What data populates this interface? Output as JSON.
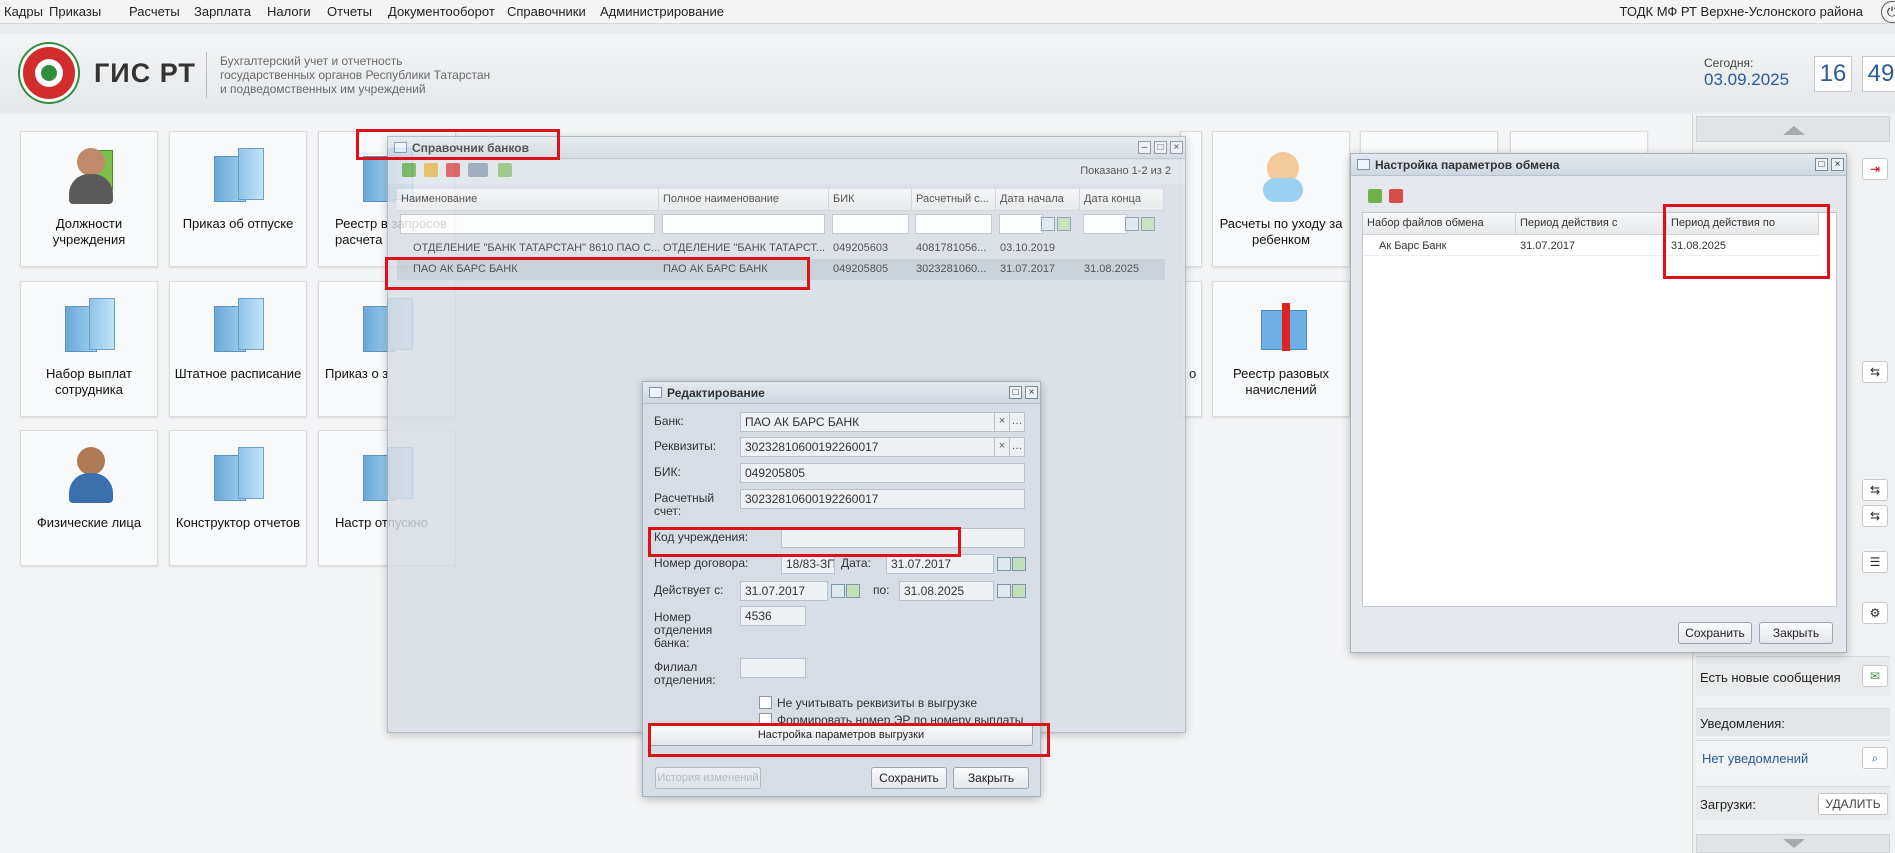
{
  "menu": {
    "items": [
      "Кадры",
      "Приказы",
      "Расчеты",
      "Зарплата",
      "Налоги",
      "Отчеты",
      "Документооборот",
      "Справочники",
      "Администрирование"
    ],
    "org": "ТОДК МФ РТ Верхне-Услонского района",
    "org_icon": "power-icon"
  },
  "header": {
    "brand": "ГИС РТ",
    "subtitle_1": "Бухгалтерский учет и отчетность",
    "subtitle_2": "государственных органов Республики Татарстан",
    "subtitle_3": "и подведомственных им учреждений",
    "today_label": "Сегодня:",
    "today_date": "03.09.2025",
    "hours": "16",
    "minutes": "49"
  },
  "tiles": [
    {
      "label": "Должности учреждения",
      "icon": "people-document-icon"
    },
    {
      "label": "Приказ об отпуске",
      "icon": "building-icon"
    },
    {
      "label": "Реестр в запросов расчета",
      "icon": "building-icon"
    },
    {
      "label": "Расчеты по уходу за ребенком",
      "icon": "baby-icon"
    },
    {
      "label": "Набор выплат сотрудника",
      "icon": "building-icon"
    },
    {
      "label": "Штатное расписание",
      "icon": "building-icon"
    },
    {
      "label": "Приказ о з",
      "icon": "building-icon"
    },
    {
      "label": "Реестр разовых начислений",
      "icon": "gift-icon"
    },
    {
      "label": "Физические лица",
      "icon": "person-icon"
    },
    {
      "label": "Конструктор отчетов",
      "icon": "building-icon"
    },
    {
      "label": "Настр отпускно",
      "icon": "building-icon"
    }
  ],
  "tile_fragment_o": "о",
  "right_panel": {
    "messages_label": "Есть новые сообщения",
    "notifications_title": "Уведомления:",
    "notifications_value": "Нет уведомлений",
    "downloads_label": "Загрузки:",
    "delete_button": "УДАЛИТЬ"
  },
  "banks_window": {
    "title": "Справочник банков",
    "shown": "Показано 1-2 из 2",
    "columns": [
      "Наименование",
      "Полное наименование",
      "БИК",
      "Расчетный с...",
      "Дата начала",
      "Дата конца"
    ],
    "rows": [
      [
        "ОТДЕЛЕНИЕ \"БАНК ТАТАРСТАН\" 8610 ПАО С...",
        "ОТДЕЛЕНИЕ \"БАНК ТАТАРСТ...",
        "049205603",
        "4081781056...",
        "03.10.2019",
        ""
      ],
      [
        "ПАО АК БАРС БАНК",
        "ПАО АК БАРС БАНК",
        "049205805",
        "3023281060...",
        "31.07.2017",
        "31.08.2025"
      ]
    ]
  },
  "edit_window": {
    "title": "Редактирование",
    "bank_label": "Банк:",
    "bank_value": "ПАО АК БАРС БАНК",
    "requisites_label": "Реквизиты:",
    "requisites_value": "30232810600192260017",
    "bik_label": "БИК:",
    "bik_value": "049205805",
    "account_label_1": "Расчетный",
    "account_label_2": "счет:",
    "account_value": "30232810600192260017",
    "org_code_label": "Код учреждения:",
    "org_code_value": "",
    "contract_label": "Номер договора:",
    "contract_value": "18/83-ЗП",
    "date_label": "Дата:",
    "date_value": "31.07.2017",
    "valid_from_label": "Действует с:",
    "valid_from_value": "31.07.2017",
    "valid_to_label": "по:",
    "valid_to_value": "31.08.2025",
    "branch_no_label_1": "Номер",
    "branch_no_label_2": "отделения",
    "branch_no_label_3": "банка:",
    "branch_no_value": "4536",
    "branch_label_1": "Филиал",
    "branch_label_2": "отделения:",
    "branch_value": "",
    "chk_ignore": "Не учитывать реквизиты в выгрузке",
    "chk_form": "Формировать номер ЭР по номеру выплаты",
    "export_settings_button": "Настройка параметров выгрузки",
    "history_button": "История изменений",
    "save_button": "Сохранить",
    "close_button": "Закрыть"
  },
  "exchange_window": {
    "title": "Настройка параметров обмена",
    "columns": [
      "Набор файлов обмена",
      "Период действия с",
      "Период действия по"
    ],
    "rows": [
      [
        "Ак Барс Банк",
        "31.07.2017",
        "31.08.2025"
      ]
    ],
    "save_button": "Сохранить",
    "close_button": "Закрыть"
  },
  "colors": {
    "highlight": "#e0101a",
    "accent": "#2a5a9a"
  }
}
